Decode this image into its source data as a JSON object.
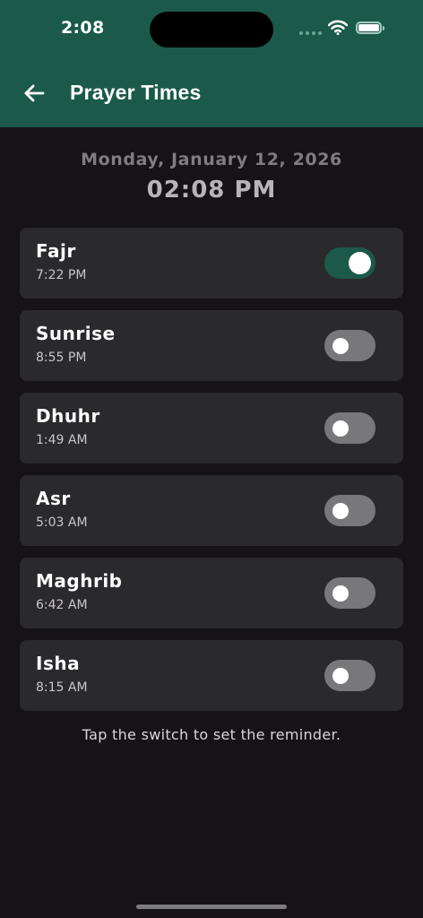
{
  "status_bar": {
    "time": "2:08"
  },
  "header": {
    "title": "Prayer Times",
    "back_icon": "arrow-left-icon"
  },
  "current": {
    "date": "Monday, January 12, 2026",
    "time": "02:08 PM"
  },
  "prayers": [
    {
      "name": "Fajr",
      "time": "7:22 PM",
      "enabled": true
    },
    {
      "name": "Sunrise",
      "time": "8:55 PM",
      "enabled": false
    },
    {
      "name": "Dhuhr",
      "time": "1:49 AM",
      "enabled": false
    },
    {
      "name": "Asr",
      "time": "5:03 AM",
      "enabled": false
    },
    {
      "name": "Maghrib",
      "time": "6:42 AM",
      "enabled": false
    },
    {
      "name": "Isha",
      "time": "8:15 AM",
      "enabled": false
    }
  ],
  "hint": "Tap the switch to set the reminder.",
  "colors": {
    "header_bg": "#1b5a4a",
    "page_bg": "#151218",
    "card_bg": "#2a292c",
    "toggle_on": "#1b5a4a",
    "toggle_off": "#787779"
  }
}
